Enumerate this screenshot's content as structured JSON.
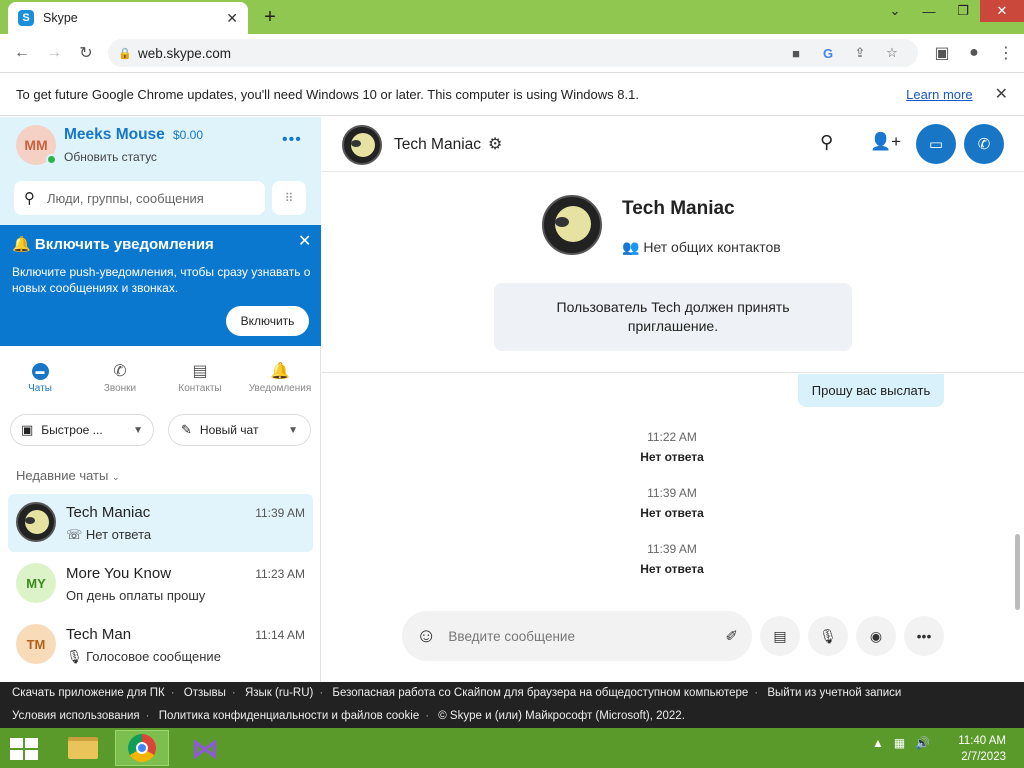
{
  "browser": {
    "tab_title": "Skype",
    "url": "web.skype.com",
    "infobar_message": "To get future Google Chrome updates, you'll need Windows 10 or later. This computer is using Windows 8.1.",
    "infobar_link": "Learn more"
  },
  "profile": {
    "initials": "MM",
    "name": "Meeks Mouse",
    "balance": "$0.00",
    "status": "Обновить статус",
    "search_placeholder": "Люди, группы, сообщения"
  },
  "notification": {
    "title": "Включить уведомления",
    "text": "Включите push-уведомления, чтобы сразу узнавать о новых сообщениях и звонках.",
    "button": "Включить"
  },
  "nav": [
    {
      "label": "Чаты",
      "icon": "chat-icon"
    },
    {
      "label": "Звонки",
      "icon": "phone-icon"
    },
    {
      "label": "Контакты",
      "icon": "contacts-icon"
    },
    {
      "label": "Уведомления",
      "icon": "bell-icon"
    }
  ],
  "quick_button": "Быстрое ...",
  "new_chat_button": "Новый чат",
  "recent_label": "Недавние чаты",
  "chats": [
    {
      "initials": "",
      "name": "Tech Maniac",
      "time": "11:39 AM",
      "preview": "Нет ответа",
      "preview_icon": "missed-call-icon"
    },
    {
      "initials": "MY",
      "name": "More You Know",
      "time": "11:23 AM",
      "preview": "Оп день оплаты прошу",
      "preview_icon": ""
    },
    {
      "initials": "TM",
      "name": "Tech Man",
      "time": "11:14 AM",
      "preview": "Голосовое сообщение",
      "preview_icon": "microphone-icon"
    }
  ],
  "conversation": {
    "name": "Tech Maniac",
    "contacts_note": "Нет общих контактов",
    "invite_text": "Пользователь Tech должен принять приглашение.",
    "sent_message": "Прошу вас выслать",
    "calls": [
      {
        "time": "11:22 AM",
        "result": "Нет ответа"
      },
      {
        "time": "11:39 AM",
        "result": "Нет ответа"
      },
      {
        "time": "11:39 AM",
        "result": "Нет ответа"
      }
    ],
    "composer_placeholder": "Введите сообщение"
  },
  "footer": {
    "row1": [
      "Скачать приложение для ПК",
      "Отзывы",
      "Язык (ru-RU)",
      "Безопасная работа со Скайпом для браузера на общедоступном компьютере",
      "Выйти из учетной записи"
    ],
    "row2": [
      "Условия использования",
      "Политика конфиденциальности и файлов cookie",
      "© Skype и (или) Майкрософт (Microsoft), 2022."
    ]
  },
  "taskbar": {
    "time": "11:40 AM",
    "date": "2/7/2023"
  },
  "colors": {
    "accent": "#1776c6",
    "notification_bg": "#0b78d0",
    "profile_bg": "#dff3fb",
    "taskbar": "#5a9a2a",
    "tabstrip": "#8fc751"
  }
}
